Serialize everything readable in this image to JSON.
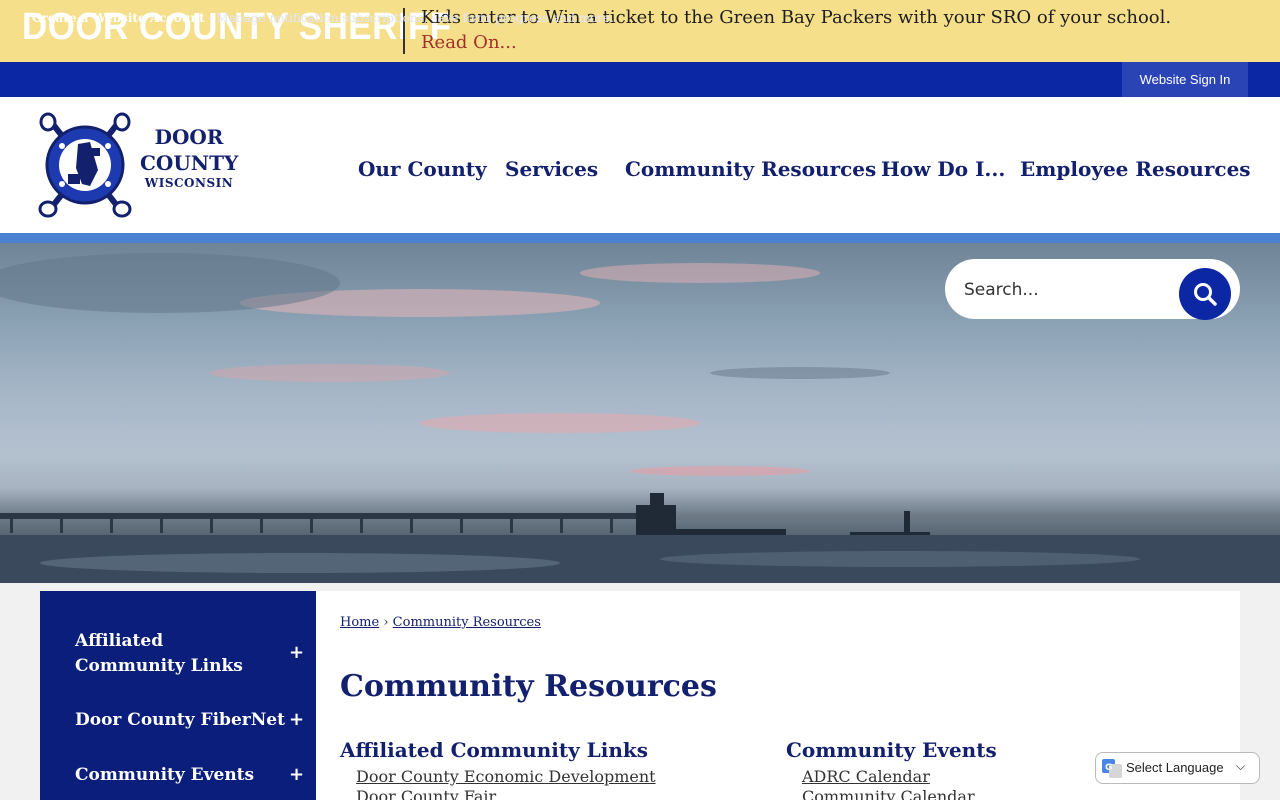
{
  "alert": {
    "title": "DOOR COUNTY SHERIFF",
    "message": "Kids enter to Win a ticket to the Green Bay Packers with your SRO of your school.",
    "link": "Read On..."
  },
  "account_bar": {
    "create_label": "Create a Website Account",
    "description": " - Manage notification subscriptions, save form progress and more.",
    "sign_in": "Website Sign In"
  },
  "logo": {
    "line1": "DOOR",
    "line2": "COUNTY",
    "line3": "WISCONSIN"
  },
  "nav": [
    {
      "label": "Our County"
    },
    {
      "label": "Services"
    },
    {
      "label": "Community Resources"
    },
    {
      "label": "How Do I..."
    },
    {
      "label": "Employee Resources"
    }
  ],
  "search": {
    "placeholder": "Search..."
  },
  "sidebar": {
    "items": [
      {
        "label": "Affiliated Community Links",
        "expander": "+"
      },
      {
        "label": "Door County FiberNet",
        "expander": "+"
      },
      {
        "label": "Community Events",
        "expander": "+"
      }
    ]
  },
  "breadcrumb": {
    "home": "Home",
    "separator": "›",
    "current": "Community Resources"
  },
  "page_title": "Community Resources",
  "sections": [
    {
      "title": "Affiliated Community Links",
      "links": [
        "Door County Economic Development",
        "Door County Fair"
      ]
    },
    {
      "title": "Community Events",
      "links": [
        "ADRC Calendar",
        "Community Calendar"
      ]
    }
  ],
  "language": {
    "label": "Select Language"
  },
  "colors": {
    "brand_navy": "#0b1e7c",
    "account_bar": "#0b27a3",
    "alert_bg": "#f6df8a",
    "link_red": "#a0302a",
    "stripe": "#4a82d1"
  }
}
